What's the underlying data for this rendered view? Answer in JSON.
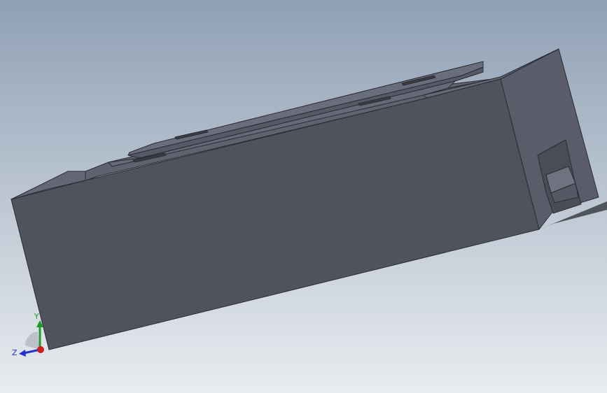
{
  "viewport": {
    "background_top": "#8fa0b4",
    "background_bottom": "#e9ecf0"
  },
  "model": {
    "face_front": "#50535e",
    "face_top": "#646876",
    "face_end": "#5a5d69",
    "edge": "#2a2c33",
    "shadow": "#3c3f47"
  },
  "triad": {
    "y_label": "Y",
    "z_label": "Z",
    "y_color": "#1f9a2a",
    "z_color": "#2233cc",
    "x_color": "#cc1f1f"
  }
}
